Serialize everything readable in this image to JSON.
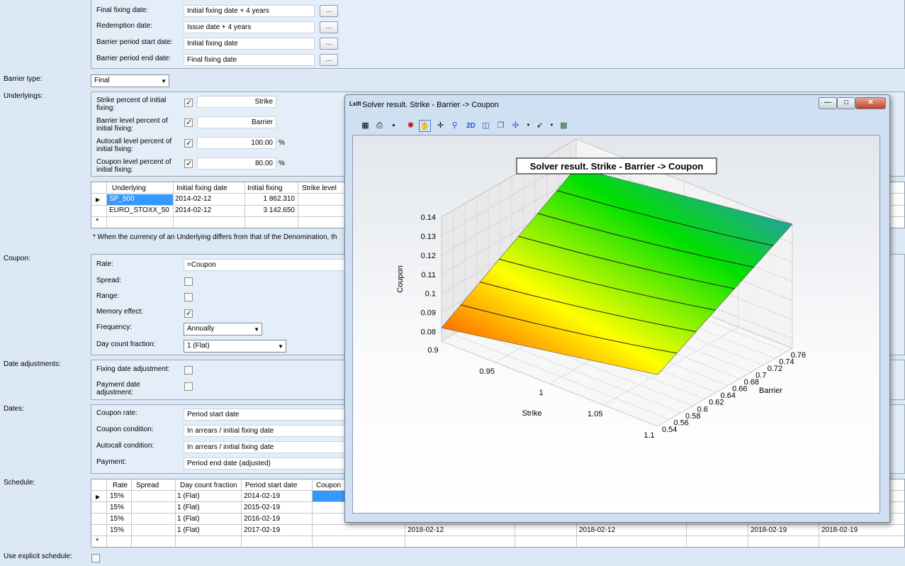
{
  "left_labels": {
    "barrier_type": "Barrier type:",
    "underlyings": "Underlyings:",
    "coupon": "Coupon:",
    "date_adjustments": "Date adjustments:",
    "dates": "Dates:",
    "schedule": "Schedule:",
    "use_explicit_schedule": "Use explicit schedule:"
  },
  "top_dates": [
    {
      "label": "Final fixing date:",
      "value": "Initial fixing date + 4 years"
    },
    {
      "label": "Redemption date:",
      "value": "Issue date + 4 years"
    },
    {
      "label": "Barrier period start date:",
      "value": "Initial fixing date"
    },
    {
      "label": "Barrier period end date:",
      "value": "Final fixing date"
    }
  ],
  "ellipsis": "...",
  "barrier_type_value": "Final",
  "underlyings_params": [
    {
      "label": "Strike percent of initial fixing:",
      "checked": true,
      "value": "Strike",
      "unit": ""
    },
    {
      "label": "Barrier level percent of initial fixing:",
      "checked": true,
      "value": "Barrier",
      "unit": ""
    },
    {
      "label": "Autocall level percent of initial fixing:",
      "checked": true,
      "value": "100.00",
      "unit": "%"
    },
    {
      "label": "Coupon level percent of initial fixing:",
      "checked": true,
      "value": "80.00",
      "unit": "%"
    }
  ],
  "underlyings_table": {
    "columns": [
      "Underlying",
      "Initial fixing date",
      "Initial fixing",
      "Strike level"
    ],
    "rows": [
      [
        "SP_500",
        "2014-02-12",
        "1 862.310",
        ""
      ],
      [
        "EURO_STOXX_50",
        "2014-02-12",
        "3 142.650",
        ""
      ]
    ],
    "new_row_mark": "*"
  },
  "currency_note": "* When the currency of an Underlying differs from that of the Denomination, th",
  "coupon": {
    "rate_label": "Rate:",
    "rate_value": "=Coupon",
    "spread_label": "Spread:",
    "spread_checked": false,
    "range_label": "Range:",
    "range_checked": false,
    "memory_label": "Memory effect:",
    "memory_checked": true,
    "frequency_label": "Frequency:",
    "frequency_value": "Annually",
    "daycount_label": "Day count fraction:",
    "daycount_value": "1 (Flat)"
  },
  "date_adjustments": {
    "fixing_label": "Fixing date adjustment:",
    "payment_label": "Payment date adjustment:"
  },
  "dates": [
    {
      "label": "Coupon rate:",
      "value": "Period start date"
    },
    {
      "label": "Coupon condition:",
      "value": "In arrears / initial fixing date"
    },
    {
      "label": "Autocall condition:",
      "value": "In arrears / initial fixing date"
    },
    {
      "label": "Payment:",
      "value": "Period end date (adjusted)"
    }
  ],
  "schedule_table": {
    "columns": [
      "Rate",
      "Spread",
      "Day count fraction",
      "Period start date",
      "Coupon"
    ],
    "rows": [
      [
        "15%",
        "",
        "1 (Flat)",
        "2014-02-19"
      ],
      [
        "15%",
        "",
        "1 (Flat)",
        "2015-02-19"
      ],
      [
        "15%",
        "",
        "1 (Flat)",
        "2016-02-19"
      ],
      [
        "15%",
        "",
        "1 (Flat)",
        "2017-02-19"
      ]
    ],
    "extra_cells_last_row": [
      "2018-02-12",
      "2018-02-12",
      "2018-02-19",
      "2018-02-19"
    ],
    "new_row_mark": "*"
  },
  "solver_window": {
    "title": "Solver result. Strike - Barrier -> Coupon",
    "icon_text": "Lxifi",
    "btn_minimize": "—",
    "btn_restore": "□",
    "btn_close": "✕",
    "toolbar": [
      {
        "icon": "properties-icon",
        "glyph": "▦"
      },
      {
        "icon": "print-icon",
        "glyph": "⎙"
      },
      {
        "icon": "save-icon",
        "glyph": "▪"
      },
      {
        "icon": "scatter-icon",
        "glyph": "✱"
      },
      {
        "icon": "pan-hand-icon",
        "glyph": "✋"
      },
      {
        "icon": "crosshair-icon",
        "glyph": "✛"
      },
      {
        "icon": "zoom-icon",
        "glyph": "⚲"
      },
      {
        "icon": "2d-icon",
        "glyph": "2D"
      },
      {
        "icon": "cube-icon",
        "glyph": "◫"
      },
      {
        "icon": "box-icon",
        "glyph": "❐"
      },
      {
        "icon": "rotate-icon",
        "glyph": "✣"
      },
      {
        "icon": "pointer-icon",
        "glyph": "➶"
      },
      {
        "icon": "chart-settings-icon",
        "glyph": "▩"
      }
    ]
  },
  "chart_data": {
    "type": "surface",
    "title": "Solver result. Strike - Barrier -> Coupon",
    "xlabel": "Strike",
    "ylabel": "Barrier",
    "zlabel": "Coupon",
    "x_ticks": [
      "0.9",
      "0.95",
      "1",
      "1.05",
      "1.1"
    ],
    "y_ticks": [
      "0.54",
      "0.56",
      "0.58",
      "0.6",
      "0.62",
      "0.64",
      "0.66",
      "0.68",
      "0.7",
      "0.72",
      "0.74",
      "0.76"
    ],
    "z_ticks": [
      "0.08",
      "0.09",
      "0.1",
      "0.11",
      "0.12",
      "0.13",
      "0.14"
    ],
    "xlim": [
      0.9,
      1.1
    ],
    "ylim": [
      0.54,
      0.77
    ],
    "zlim": [
      0.075,
      0.14
    ],
    "surface_corners": [
      {
        "strike": 0.9,
        "barrier": 0.54,
        "coupon": 0.082
      },
      {
        "strike": 1.1,
        "barrier": 0.54,
        "coupon": 0.102
      },
      {
        "strike": 1.1,
        "barrier": 0.77,
        "coupon": 0.14
      },
      {
        "strike": 0.9,
        "barrier": 0.77,
        "coupon": 0.125
      }
    ],
    "colormap": [
      "#ff2a00",
      "#ffff00",
      "#00e000",
      "#3a7cff"
    ]
  }
}
